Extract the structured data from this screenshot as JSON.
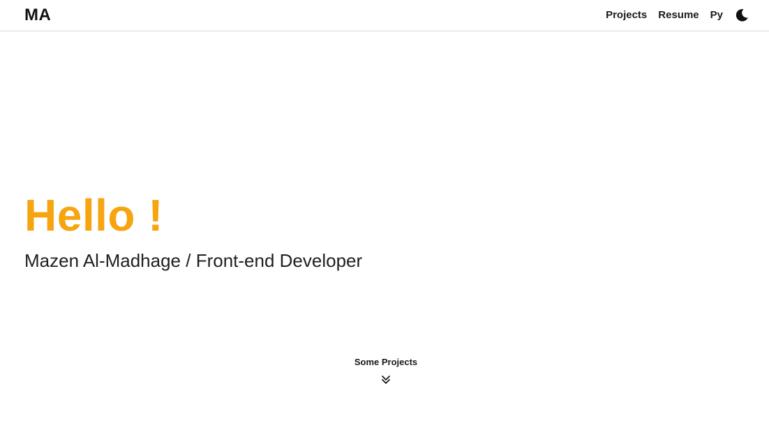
{
  "header": {
    "logo": "MA",
    "nav": [
      {
        "label": "Projects"
      },
      {
        "label": "Resume"
      },
      {
        "label": "Py"
      }
    ],
    "theme_toggle_icon": "moon-icon"
  },
  "hero": {
    "title": "Hello !",
    "subtitle": "Mazen Al-Madhage / Front-end Developer"
  },
  "scroll_cue": {
    "label": "Some Projects",
    "icon": "double-chevron-down-icon"
  },
  "colors": {
    "accent": "#f6a40f",
    "text": "#111111",
    "background": "#ffffff",
    "divider": "#d9d9d9"
  }
}
